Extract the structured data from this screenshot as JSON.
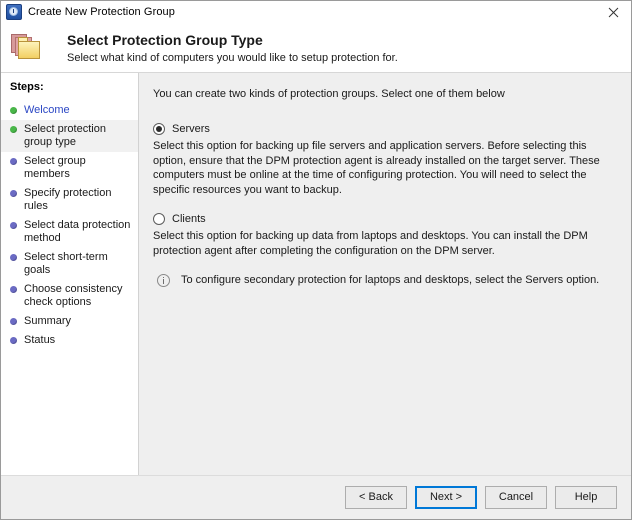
{
  "window": {
    "title": "Create New Protection Group",
    "app_icon": "dpm-clock-icon",
    "close_label": "✕"
  },
  "header": {
    "icon": "folder-stack-icon",
    "title": "Select Protection Group Type",
    "subtitle": "Select what kind of computers you would like to setup protection for."
  },
  "sidebar": {
    "label": "Steps:",
    "items": [
      {
        "label": "Welcome",
        "state": "done",
        "current": false,
        "link": true
      },
      {
        "label": "Select protection group type",
        "state": "done",
        "current": true,
        "link": false
      },
      {
        "label": "Select group members",
        "state": "todo",
        "current": false,
        "link": false
      },
      {
        "label": "Specify protection rules",
        "state": "todo",
        "current": false,
        "link": false
      },
      {
        "label": "Select data protection method",
        "state": "todo",
        "current": false,
        "link": false
      },
      {
        "label": "Select short-term goals",
        "state": "todo",
        "current": false,
        "link": false
      },
      {
        "label": "Choose consistency check options",
        "state": "todo",
        "current": false,
        "link": false
      },
      {
        "label": "Summary",
        "state": "todo",
        "current": false,
        "link": false
      },
      {
        "label": "Status",
        "state": "todo",
        "current": false,
        "link": false
      }
    ]
  },
  "content": {
    "intro": "You can create two kinds of protection groups. Select one of them below",
    "options": [
      {
        "id": "servers",
        "label": "Servers",
        "selected": true,
        "description": "Select this option for backing up file servers and application servers. Before selecting this option, ensure that the DPM protection agent is already installed on the target server. These computers must be online at the time of configuring protection. You will need to select the specific resources you want to backup."
      },
      {
        "id": "clients",
        "label": "Clients",
        "selected": false,
        "description": "Select this option for backing up data from laptops and desktops. You can install the DPM protection agent after completing the configuration on the DPM server."
      }
    ],
    "note": {
      "icon": "info-icon",
      "text": "To configure secondary protection for laptops and desktops, select the Servers option."
    }
  },
  "footer": {
    "buttons": [
      {
        "label": "< Back",
        "default": false
      },
      {
        "label": "Next >",
        "default": true
      },
      {
        "label": "Cancel",
        "default": false
      },
      {
        "label": "Help",
        "default": false
      }
    ]
  },
  "colors": {
    "accent": "#0078d7",
    "step_done": "#49b749",
    "step_todo": "#6b6bc4",
    "link": "#2b47c4",
    "content_bg": "#efefef",
    "sidebar_bg": "#ffffff"
  }
}
